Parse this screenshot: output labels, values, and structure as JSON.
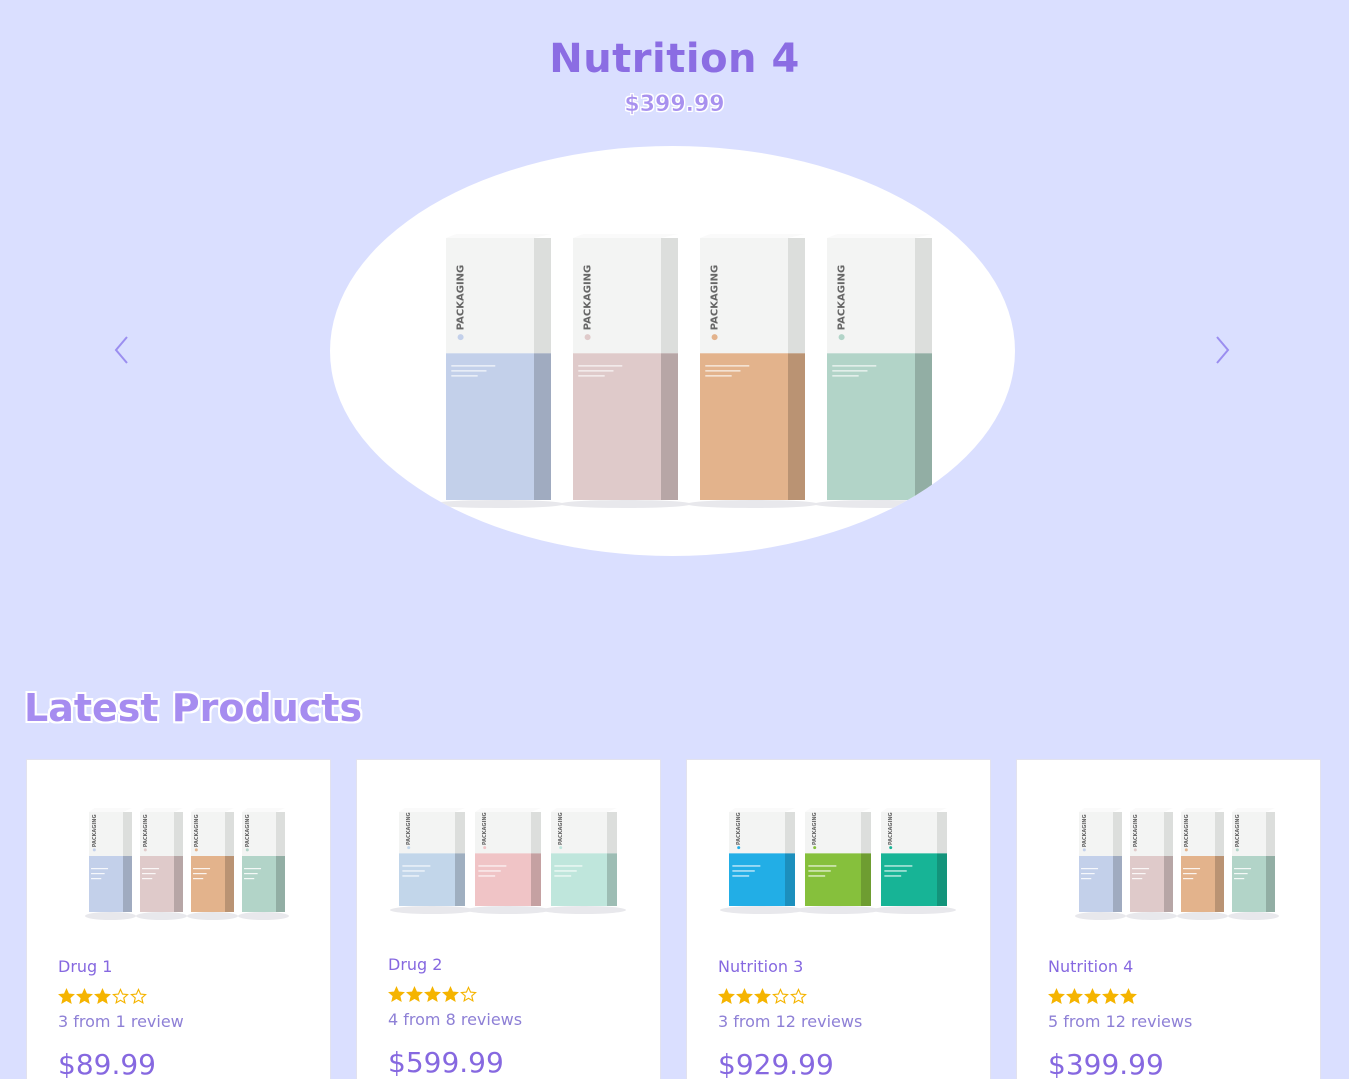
{
  "hero": {
    "title": "Nutrition 4",
    "price": "$399.99",
    "prev_icon": "chevron-left-icon",
    "next_icon": "chevron-right-icon"
  },
  "latest": {
    "title": "Latest Products",
    "products": [
      {
        "name": "Drug 1",
        "rating": 3,
        "reviews": "3 from 1 review",
        "price": "$89.99",
        "palette": [
          "#c3d0ea",
          "#dfcaca",
          "#e3b38c",
          "#b2d4c8"
        ]
      },
      {
        "name": "Drug 2",
        "rating": 4,
        "reviews": "4 from 8 reviews",
        "price": "$599.99",
        "palette": [
          "#c2d6ea",
          "#f0c4c6",
          "#bfe6dc"
        ]
      },
      {
        "name": "Nutrition 3",
        "rating": 3,
        "reviews": "3 from 12 reviews",
        "price": "$929.99",
        "palette": [
          "#22aee6",
          "#86c03c",
          "#17b496"
        ]
      },
      {
        "name": "Nutrition 4",
        "rating": 5,
        "reviews": "5 from 12 reviews",
        "price": "$399.99",
        "palette": [
          "#c3d0ea",
          "#dfcaca",
          "#e3b38c",
          "#b2d4c8"
        ]
      }
    ]
  },
  "colors": {
    "background": "#dadfff",
    "accent": "#8b6de3",
    "star": "#f5b400"
  }
}
